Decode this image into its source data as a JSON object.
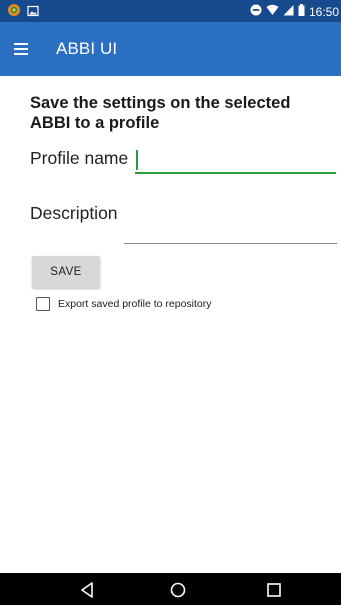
{
  "status_bar": {
    "time": "16:50",
    "icons": [
      "app-notification-icon",
      "image-notification-icon",
      "do-not-disturb-icon",
      "wifi-icon",
      "signal-icon",
      "battery-icon"
    ]
  },
  "app_bar": {
    "title": "ABBI UI",
    "menu_icon": "menu-icon"
  },
  "form": {
    "heading": "Save the settings on the selected ABBI to a profile",
    "profile_name_label": "Profile name",
    "profile_name_value": "",
    "description_label": "Description",
    "description_value": "",
    "save_label": "SAVE",
    "export_label": "Export saved profile to repository",
    "export_checked": false
  },
  "nav_bar": {
    "icons": [
      "back-icon",
      "home-icon",
      "recents-icon"
    ]
  },
  "colors": {
    "status_bar": "#174a8c",
    "app_bar": "#2a6fc2",
    "input_focus": "#2e9a3a"
  }
}
